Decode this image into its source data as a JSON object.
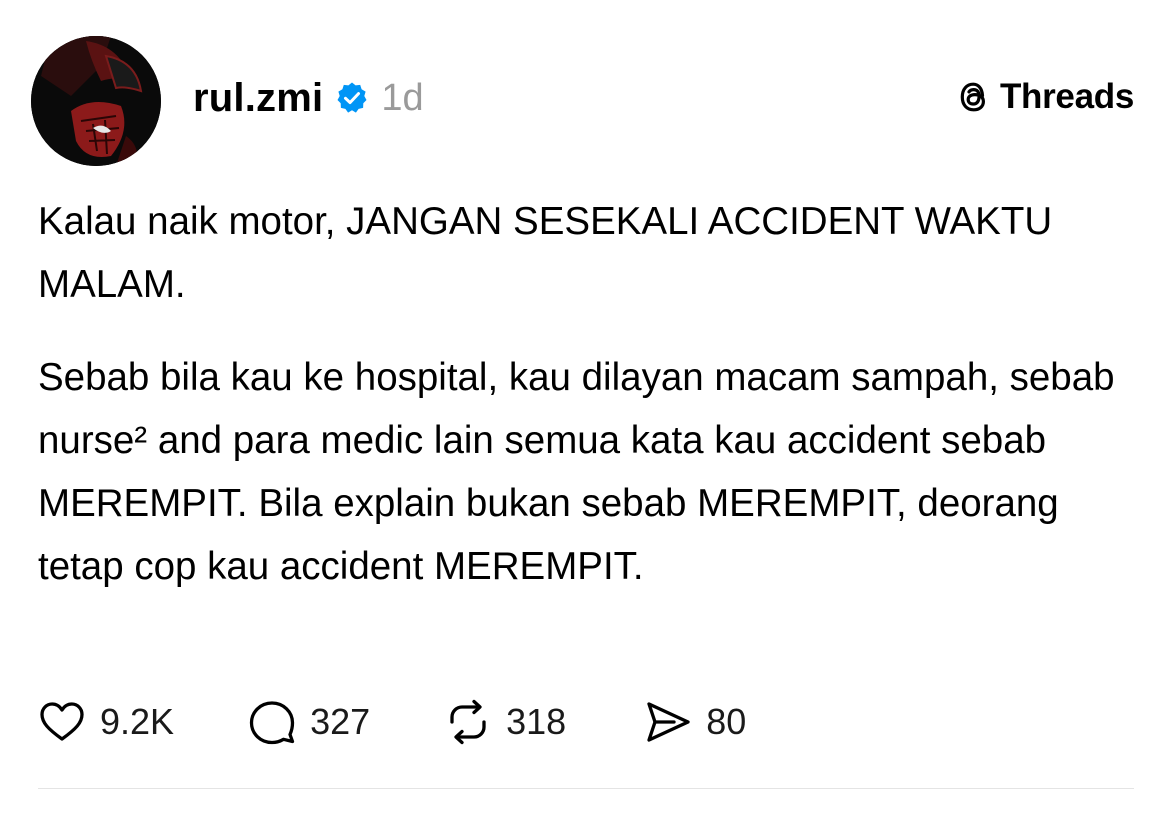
{
  "post": {
    "username": "rul.zmi",
    "timestamp": "1d",
    "verified": true,
    "paragraphs": [
      "Kalau naik motor, JANGAN SESEKALI ACCIDENT WAKTU MALAM.",
      "Sebab bila kau ke hospital, kau dilayan macam sampah, sebab nurse² and para medic lain semua kata kau accident sebab MEREMPIT. Bila explain bukan sebab MEREMPIT, deorang tetap cop kau accident MEREMPIT."
    ]
  },
  "brand": {
    "name": "Threads",
    "icon": "threads-logo-icon"
  },
  "actions": {
    "likes": "9.2K",
    "replies": "327",
    "reposts": "318",
    "shares": "80"
  },
  "colors": {
    "verified": "#0095F6",
    "muted": "#9A9A9A",
    "text": "#000000"
  }
}
